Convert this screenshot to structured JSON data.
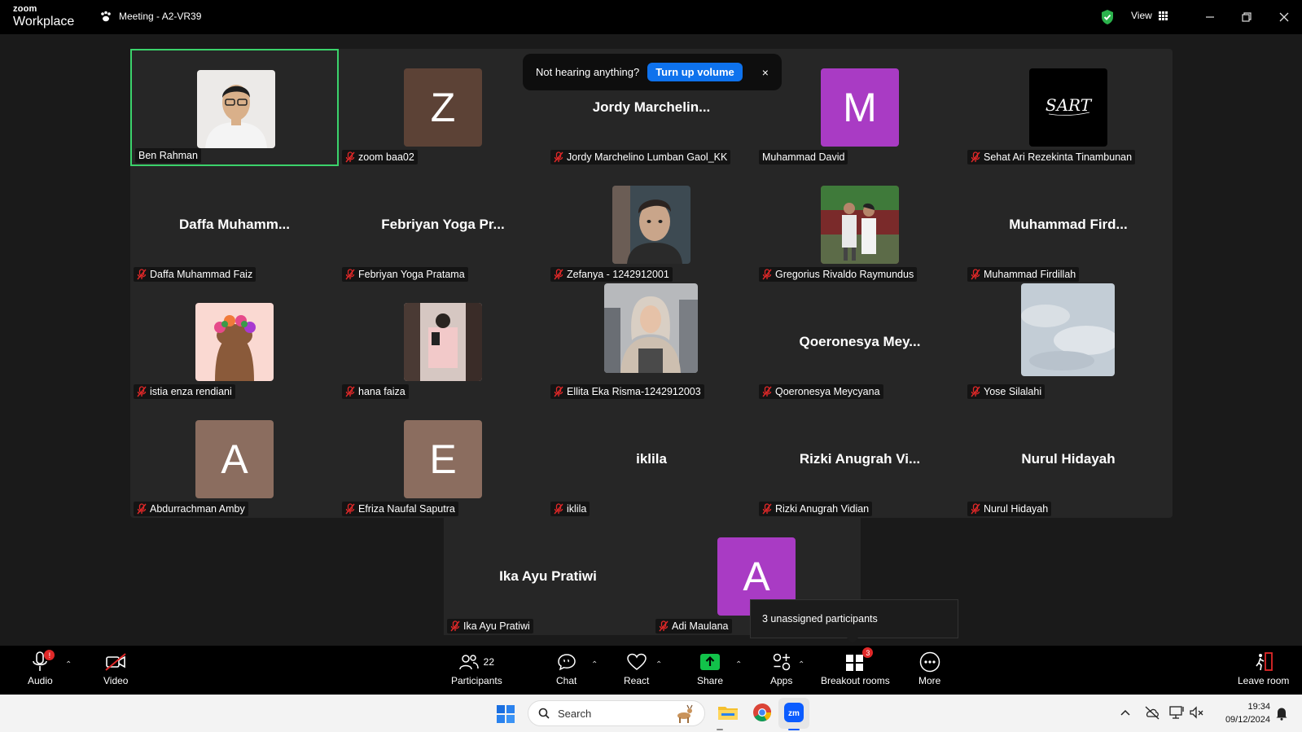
{
  "app": {
    "brand_small": "zoom",
    "brand_large": "Workplace",
    "meeting_title": "Meeting - A2-VR39",
    "view_label": "View"
  },
  "banner": {
    "text": "Not hearing anything?",
    "button": "Turn up volume",
    "close": "×"
  },
  "tiles": [
    {
      "name": "Ben Rahman",
      "type": "photo",
      "photo": "man"
    },
    {
      "name": "zoom baa02",
      "type": "letter",
      "letter": "Z",
      "color": "#5c4236"
    },
    {
      "name": "Jordy Marchelino Lumban Gaol_KK",
      "type": "text",
      "display": "Jordy  Marchelin..."
    },
    {
      "name": "Muhammad David",
      "type": "letter",
      "letter": "M",
      "color": "#a93bc4"
    },
    {
      "name": "Sehat Ari Rezekinta Tinambunan",
      "type": "photo",
      "photo": "sart"
    },
    {
      "name": "Daffa Muhammad Faiz",
      "type": "text",
      "display": "Daffa  Muhamm..."
    },
    {
      "name": "Febriyan Yoga Pratama",
      "type": "text",
      "display": "Febriyan Yoga Pr..."
    },
    {
      "name": "Zefanya - 1242912001",
      "type": "photo",
      "photo": "boy"
    },
    {
      "name": "Gregorius Rivaldo Raymundus",
      "type": "photo",
      "photo": "couple"
    },
    {
      "name": "Muhammad Firdillah",
      "type": "text",
      "display": "Muhammad  Fird..."
    },
    {
      "name": "istia enza rendiani",
      "type": "photo",
      "photo": "flowers"
    },
    {
      "name": "hana faiza",
      "type": "photo",
      "photo": "mirror"
    },
    {
      "name": "Ellita Eka Risma-1242912003",
      "type": "photo",
      "photo": "hijab"
    },
    {
      "name": "Qoeronesya Meycyana",
      "type": "text",
      "display": "Qoeronesya  Mey..."
    },
    {
      "name": "Yose Silalahi",
      "type": "photo",
      "photo": "sky"
    },
    {
      "name": "Abdurrachman Amby",
      "type": "letter",
      "letter": "A",
      "color": "#8b6d5f"
    },
    {
      "name": "Efriza Naufal Saputra",
      "type": "letter",
      "letter": "E",
      "color": "#8b6d5f"
    },
    {
      "name": "iklila",
      "type": "text",
      "display": "iklila"
    },
    {
      "name": "Rizki Anugrah Vidian",
      "type": "text",
      "display": "Rizki  Anugrah  Vi..."
    },
    {
      "name": "Nurul Hidayah",
      "type": "text",
      "display": "Nurul Hidayah"
    },
    {
      "name": "Ika Ayu Pratiwi",
      "type": "text",
      "display": "Ika Ayu Pratiwi"
    },
    {
      "name": "Adi Maulana",
      "type": "letter",
      "letter": "A",
      "color": "#a93bc4"
    }
  ],
  "tooltip": {
    "text": "3 unassigned participants"
  },
  "toolbar": {
    "audio": "Audio",
    "audio_badge": "!",
    "video": "Video",
    "participants": "Participants",
    "participants_count": "22",
    "chat": "Chat",
    "react": "React",
    "share": "Share",
    "apps": "Apps",
    "breakout": "Breakout rooms",
    "breakout_badge": "3",
    "more": "More",
    "leave": "Leave room"
  },
  "taskbar": {
    "search_placeholder": "Search",
    "time": "19:34",
    "date": "09/12/2024"
  },
  "colors": {
    "active_border": "#3bd26b",
    "primary": "#0e72ed",
    "share_green": "#12c24a",
    "mute_red": "#e02828"
  }
}
